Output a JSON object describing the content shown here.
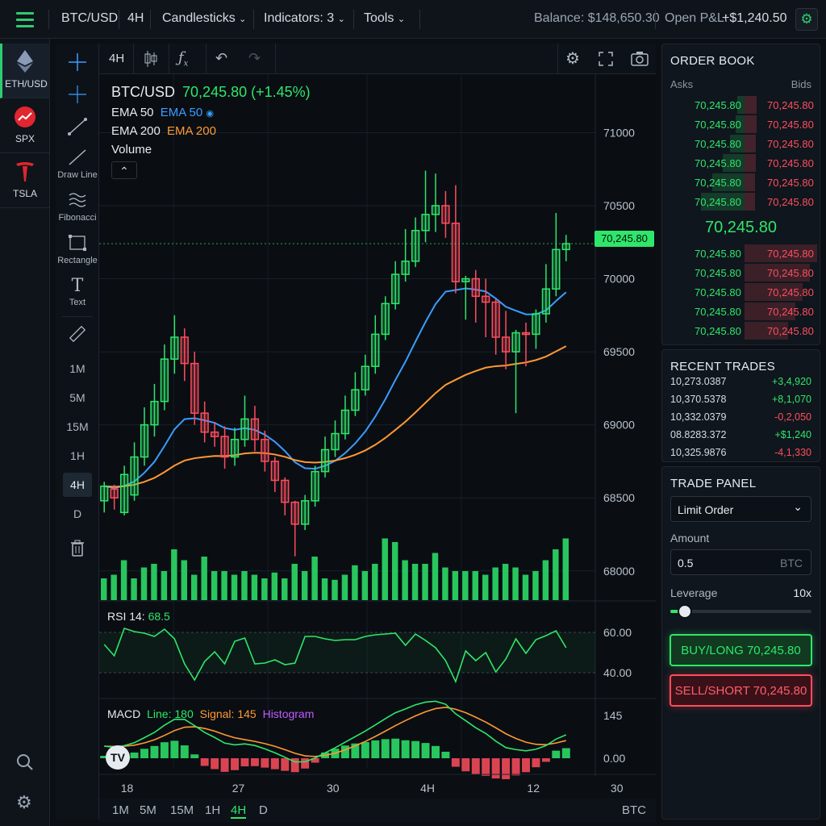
{
  "topbar": {
    "symbol": "BTC/USD",
    "interval": "4H",
    "chart_type": "Candlesticks",
    "indicators": "Indicators: 3",
    "tools": "Tools",
    "balance": "Balance: $148,650.30",
    "open_pnl_label": "Open P&L:",
    "open_pnl_value": "+$1,240.50"
  },
  "watchlist": [
    {
      "label": "ETH/USD"
    },
    {
      "label": "SPX"
    },
    {
      "label": "TSLA"
    }
  ],
  "drawing_tools": {
    "draw_line": "Draw Line",
    "fibonacci": "Fibonacci",
    "rectangle": "Rectangle",
    "text": "Text",
    "text_glyph": "T",
    "intervals": [
      "1M",
      "5M",
      "15M",
      "1H",
      "4H",
      "D"
    ],
    "active_interval": "4H"
  },
  "chart_header": {
    "interval": "4H"
  },
  "legend": {
    "symbol": "BTC/USD",
    "price": "70,245.80 (+1.45%)",
    "ema50_label": "EMA 50",
    "ema50_value": "EMA 50",
    "ema200_label": "EMA 200",
    "ema200_value": "EMA 200",
    "volume_label": "Volume"
  },
  "current_price_tag": "70,245.80",
  "chart_data": {
    "type": "candlestick",
    "y_ticks": [
      "71000",
      "70500",
      "70000",
      "69500",
      "69000",
      "68500",
      "68000"
    ],
    "ylim": [
      67800,
      71400
    ],
    "x_ticks": [
      "18",
      "27",
      "30",
      "4H",
      "12",
      "30"
    ],
    "candles": [
      [
        68480,
        68580,
        68400,
        68610
      ],
      [
        68560,
        68500,
        68420,
        68590
      ],
      [
        68400,
        68660,
        68380,
        68720
      ],
      [
        68520,
        68780,
        68480,
        68880
      ],
      [
        68780,
        69000,
        68720,
        69120
      ],
      [
        69000,
        69160,
        68920,
        69280
      ],
      [
        69160,
        69450,
        69100,
        69550
      ],
      [
        69450,
        69600,
        69350,
        69750
      ],
      [
        69600,
        69420,
        69300,
        69660
      ],
      [
        69420,
        69080,
        69000,
        69500
      ],
      [
        69080,
        68950,
        68880,
        69160
      ],
      [
        68950,
        68920,
        68850,
        69020
      ],
      [
        68920,
        68780,
        68700,
        68990
      ],
      [
        68780,
        68900,
        68720,
        68980
      ],
      [
        68900,
        69040,
        68850,
        69200
      ],
      [
        69040,
        68900,
        68820,
        69130
      ],
      [
        68900,
        68750,
        68680,
        68960
      ],
      [
        68750,
        68620,
        68540,
        68780
      ],
      [
        68620,
        68470,
        68380,
        68640
      ],
      [
        68470,
        68320,
        68100,
        68480
      ],
      [
        68320,
        68480,
        68280,
        68520
      ],
      [
        68480,
        68680,
        68440,
        68720
      ],
      [
        68680,
        68830,
        68640,
        68920
      ],
      [
        68830,
        68940,
        68780,
        69030
      ],
      [
        68940,
        69100,
        68900,
        69200
      ],
      [
        69100,
        69240,
        69060,
        69360
      ],
      [
        69240,
        69400,
        69200,
        69480
      ],
      [
        69400,
        69620,
        69350,
        69750
      ],
      [
        69620,
        69830,
        69580,
        69880
      ],
      [
        69830,
        70030,
        69790,
        70120
      ],
      [
        70030,
        70120,
        69980,
        70340
      ],
      [
        70120,
        70330,
        70080,
        70420
      ],
      [
        70330,
        70440,
        70250,
        70740
      ],
      [
        70440,
        70500,
        70320,
        70720
      ],
      [
        70500,
        70380,
        70280,
        70600
      ],
      [
        70380,
        69980,
        69900,
        70640
      ],
      [
        69980,
        70000,
        69720,
        70020
      ],
      [
        70000,
        69880,
        69700,
        70060
      ],
      [
        69880,
        69840,
        69600,
        70000
      ],
      [
        69840,
        69600,
        69480,
        69860
      ],
      [
        69600,
        69500,
        69380,
        69780
      ],
      [
        69500,
        69630,
        69080,
        69650
      ],
      [
        69630,
        69620,
        69400,
        69700
      ],
      [
        69620,
        69760,
        69520,
        69790
      ],
      [
        69760,
        69930,
        69700,
        70100
      ],
      [
        69930,
        70200,
        69880,
        70450
      ],
      [
        70200,
        70240,
        70120,
        70300
      ]
    ],
    "volume": [
      0.3,
      0.35,
      0.55,
      0.3,
      0.45,
      0.5,
      0.4,
      0.7,
      0.55,
      0.35,
      0.6,
      0.4,
      0.4,
      0.35,
      0.4,
      0.35,
      0.3,
      0.38,
      0.3,
      0.5,
      0.4,
      0.6,
      0.3,
      0.28,
      0.35,
      0.48,
      0.4,
      0.5,
      0.85,
      0.8,
      0.55,
      0.5,
      0.5,
      0.65,
      0.45,
      0.4,
      0.4,
      0.4,
      0.35,
      0.45,
      0.5,
      0.45,
      0.35,
      0.4,
      0.55,
      0.7,
      0.85
    ],
    "rsi": {
      "label": "RSI 14:",
      "value": "68.5",
      "ticks": [
        "60.00",
        "40.00"
      ]
    },
    "macd": {
      "label": "MACD",
      "line": "Line: 180",
      "signal": "Signal: 145",
      "histogram": "Histogram",
      "ticks": [
        "145",
        "0.00"
      ]
    }
  },
  "timeframe_bar": {
    "items": [
      "1M",
      "5M",
      "15M",
      "1H",
      "4H",
      "D"
    ],
    "active": "4H",
    "currency": "BTC"
  },
  "order_book": {
    "title": "ORDER BOOK",
    "asks_label": "Asks",
    "bids_label": "Bids",
    "upper": [
      {
        "ask": "70,245.80",
        "bid": "70,245.80"
      },
      {
        "ask": "70,245.80",
        "bid": "70,245.80"
      },
      {
        "ask": "70,245.80",
        "bid": "70,245.80"
      },
      {
        "ask": "70,245.80",
        "bid": "70,245.80"
      },
      {
        "ask": "70,245.80",
        "bid": "70,245.80"
      },
      {
        "ask": "70,245.80",
        "bid": "70,245.80"
      }
    ],
    "mid_price": "70,245.80",
    "lower": [
      {
        "ask": "70,245.80",
        "bid": "70,245.80"
      },
      {
        "ask": "70,245.80",
        "bid": "70,245.80"
      },
      {
        "ask": "70,245.80",
        "bid": "70,245.80"
      },
      {
        "ask": "70,245.80",
        "bid": "70,245.80"
      },
      {
        "ask": "70,245.80",
        "bid": "70,245.80"
      }
    ]
  },
  "recent_trades": {
    "title": "RECENT TRADES",
    "rows": [
      {
        "price": "10,273.0387",
        "change": "+3,4,920"
      },
      {
        "price": "10,370.5378",
        "change": "+8,1,070"
      },
      {
        "price": "10,332.0379",
        "change": "-0,2,050"
      },
      {
        "price": "08.8283.372",
        "change": "+$1,240"
      },
      {
        "price": "10,325.9876",
        "change": "-4,1,330"
      }
    ]
  },
  "trade_panel": {
    "title": "TRADE PANEL",
    "order_type": "Limit Order",
    "amount_label": "Amount",
    "amount_value": "0.5",
    "amount_unit": "BTC",
    "leverage_label": "Leverage",
    "leverage_value": "10x",
    "leverage_fraction": 0.1,
    "buy_label": "BUY/LONG  70,245.80",
    "sell_label": "SELL/SHORT  70,245.80"
  },
  "colors": {
    "up": "#2ee66b",
    "down": "#ff4d5e",
    "ema50": "#3b9cff",
    "ema200": "#ff9933",
    "macd_signal": "#ff9933",
    "histogram_label": "#c05cff"
  }
}
